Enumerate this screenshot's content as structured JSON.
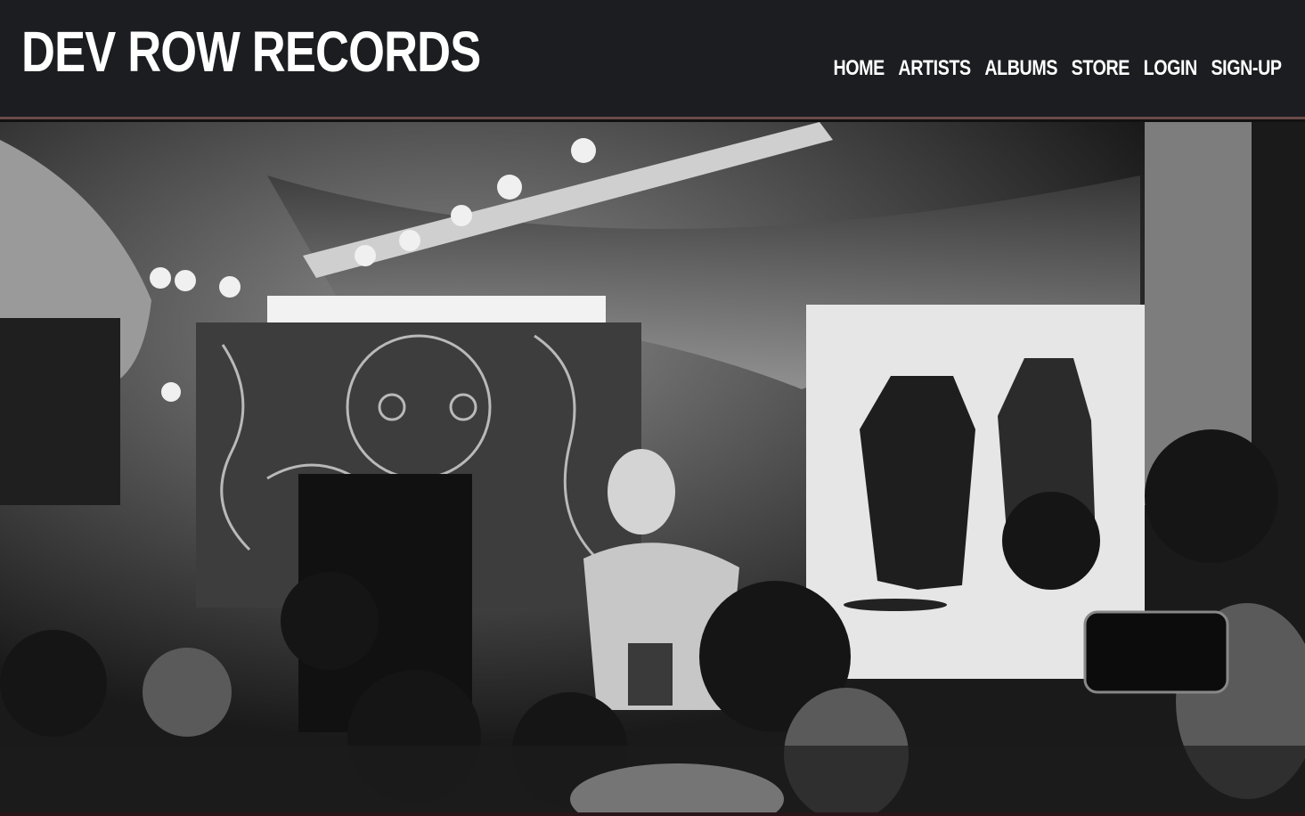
{
  "site": {
    "logo": "DEV ROW RECORDS"
  },
  "nav": {
    "items": [
      {
        "label": "HOME"
      },
      {
        "label": "ARTISTS"
      },
      {
        "label": "ALBUMS"
      },
      {
        "label": "STORE"
      },
      {
        "label": "LOGIN"
      },
      {
        "label": "SIGN-UP"
      }
    ]
  },
  "colors": {
    "header_bg": "#1b1d20",
    "header_border": "#6a4a48",
    "text": "#ffffff"
  }
}
